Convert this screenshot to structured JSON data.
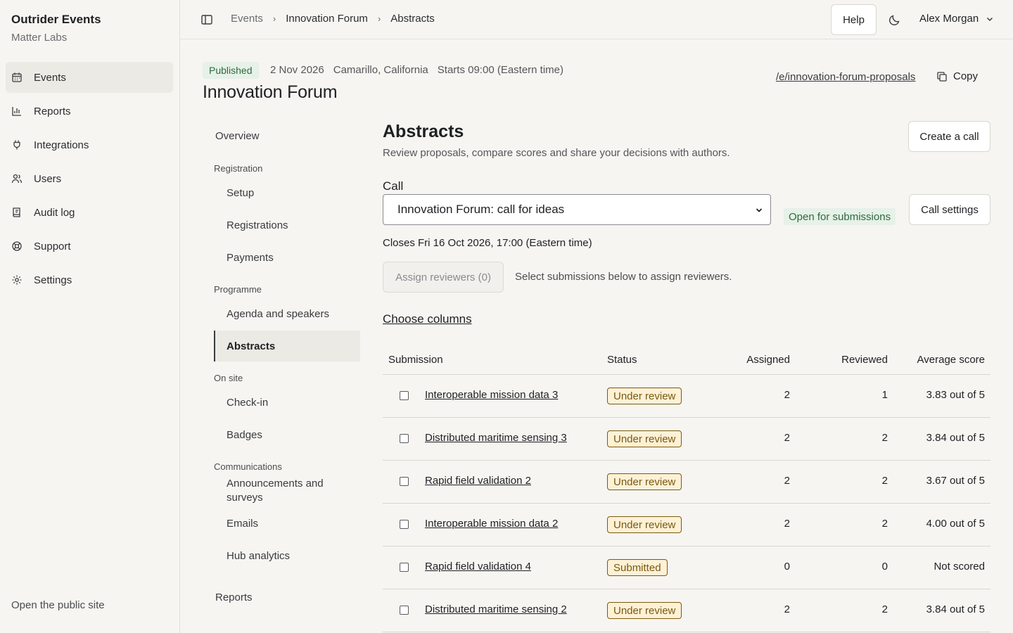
{
  "org": {
    "name": "Outrider Events",
    "subtitle": "Matter Labs"
  },
  "sidebar": {
    "items": [
      {
        "label": "Events",
        "icon": "calendar-icon",
        "active": true
      },
      {
        "label": "Reports",
        "icon": "bar-chart-icon"
      },
      {
        "label": "Integrations",
        "icon": "plug-icon"
      },
      {
        "label": "Users",
        "icon": "users-icon"
      },
      {
        "label": "Audit log",
        "icon": "book-icon"
      },
      {
        "label": "Support",
        "icon": "lifebuoy-icon"
      },
      {
        "label": "Settings",
        "icon": "gear-icon"
      }
    ],
    "footer_link": "Open the public site"
  },
  "topbar": {
    "breadcrumbs": [
      "Events",
      "Innovation Forum",
      "Abstracts"
    ],
    "help_label": "Help",
    "user_name": "Alex Morgan"
  },
  "event": {
    "status": "Published",
    "date": "2 Nov 2026",
    "location": "Camarillo, California",
    "start": "Starts 09:00 (Eastern time)",
    "title": "Innovation Forum",
    "public_url": "/e/innovation-forum-proposals",
    "copy_label": "Copy"
  },
  "subnav": {
    "overview": "Overview",
    "groups": [
      {
        "title": "Registration",
        "items": [
          "Setup",
          "Registrations",
          "Payments"
        ]
      },
      {
        "title": "Programme",
        "items": [
          "Agenda and speakers",
          "Abstracts"
        ]
      },
      {
        "title": "On site",
        "items": [
          "Check-in",
          "Badges"
        ]
      },
      {
        "title": "Communications",
        "items": [
          "Announcements and surveys",
          "Emails",
          "Hub analytics"
        ]
      }
    ],
    "active": "Abstracts",
    "reports": "Reports"
  },
  "main": {
    "title": "Abstracts",
    "subtitle": "Review proposals, compare scores and share your decisions with authors.",
    "create_call_label": "Create a call",
    "call_label": "Call",
    "call_selected": "Innovation Forum: call for ideas",
    "call_status": "Open for submissions",
    "call_settings_label": "Call settings",
    "closes": "Closes Fri 16 Oct 2026, 17:00 (Eastern time)",
    "assign_label": "Assign reviewers (0)",
    "assign_hint": "Select submissions below to assign reviewers.",
    "choose_columns": "Choose columns"
  },
  "table": {
    "headers": [
      "Submission",
      "Status",
      "Assigned",
      "Reviewed",
      "Average score"
    ],
    "rows": [
      {
        "submission": "Interoperable mission data 3",
        "status": "Under review",
        "assigned": "2",
        "reviewed": "1",
        "score": "3.83 out of 5"
      },
      {
        "submission": "Distributed maritime sensing 3",
        "status": "Under review",
        "assigned": "2",
        "reviewed": "2",
        "score": "3.84 out of 5"
      },
      {
        "submission": "Rapid field validation 2",
        "status": "Under review",
        "assigned": "2",
        "reviewed": "2",
        "score": "3.67 out of 5"
      },
      {
        "submission": "Interoperable mission data 2",
        "status": "Under review",
        "assigned": "2",
        "reviewed": "2",
        "score": "4.00 out of 5"
      },
      {
        "submission": "Rapid field validation 4",
        "status": "Submitted",
        "assigned": "0",
        "reviewed": "0",
        "score": "Not scored"
      },
      {
        "submission": "Distributed maritime sensing 2",
        "status": "Under review",
        "assigned": "2",
        "reviewed": "2",
        "score": "3.84 out of 5"
      }
    ]
  }
}
